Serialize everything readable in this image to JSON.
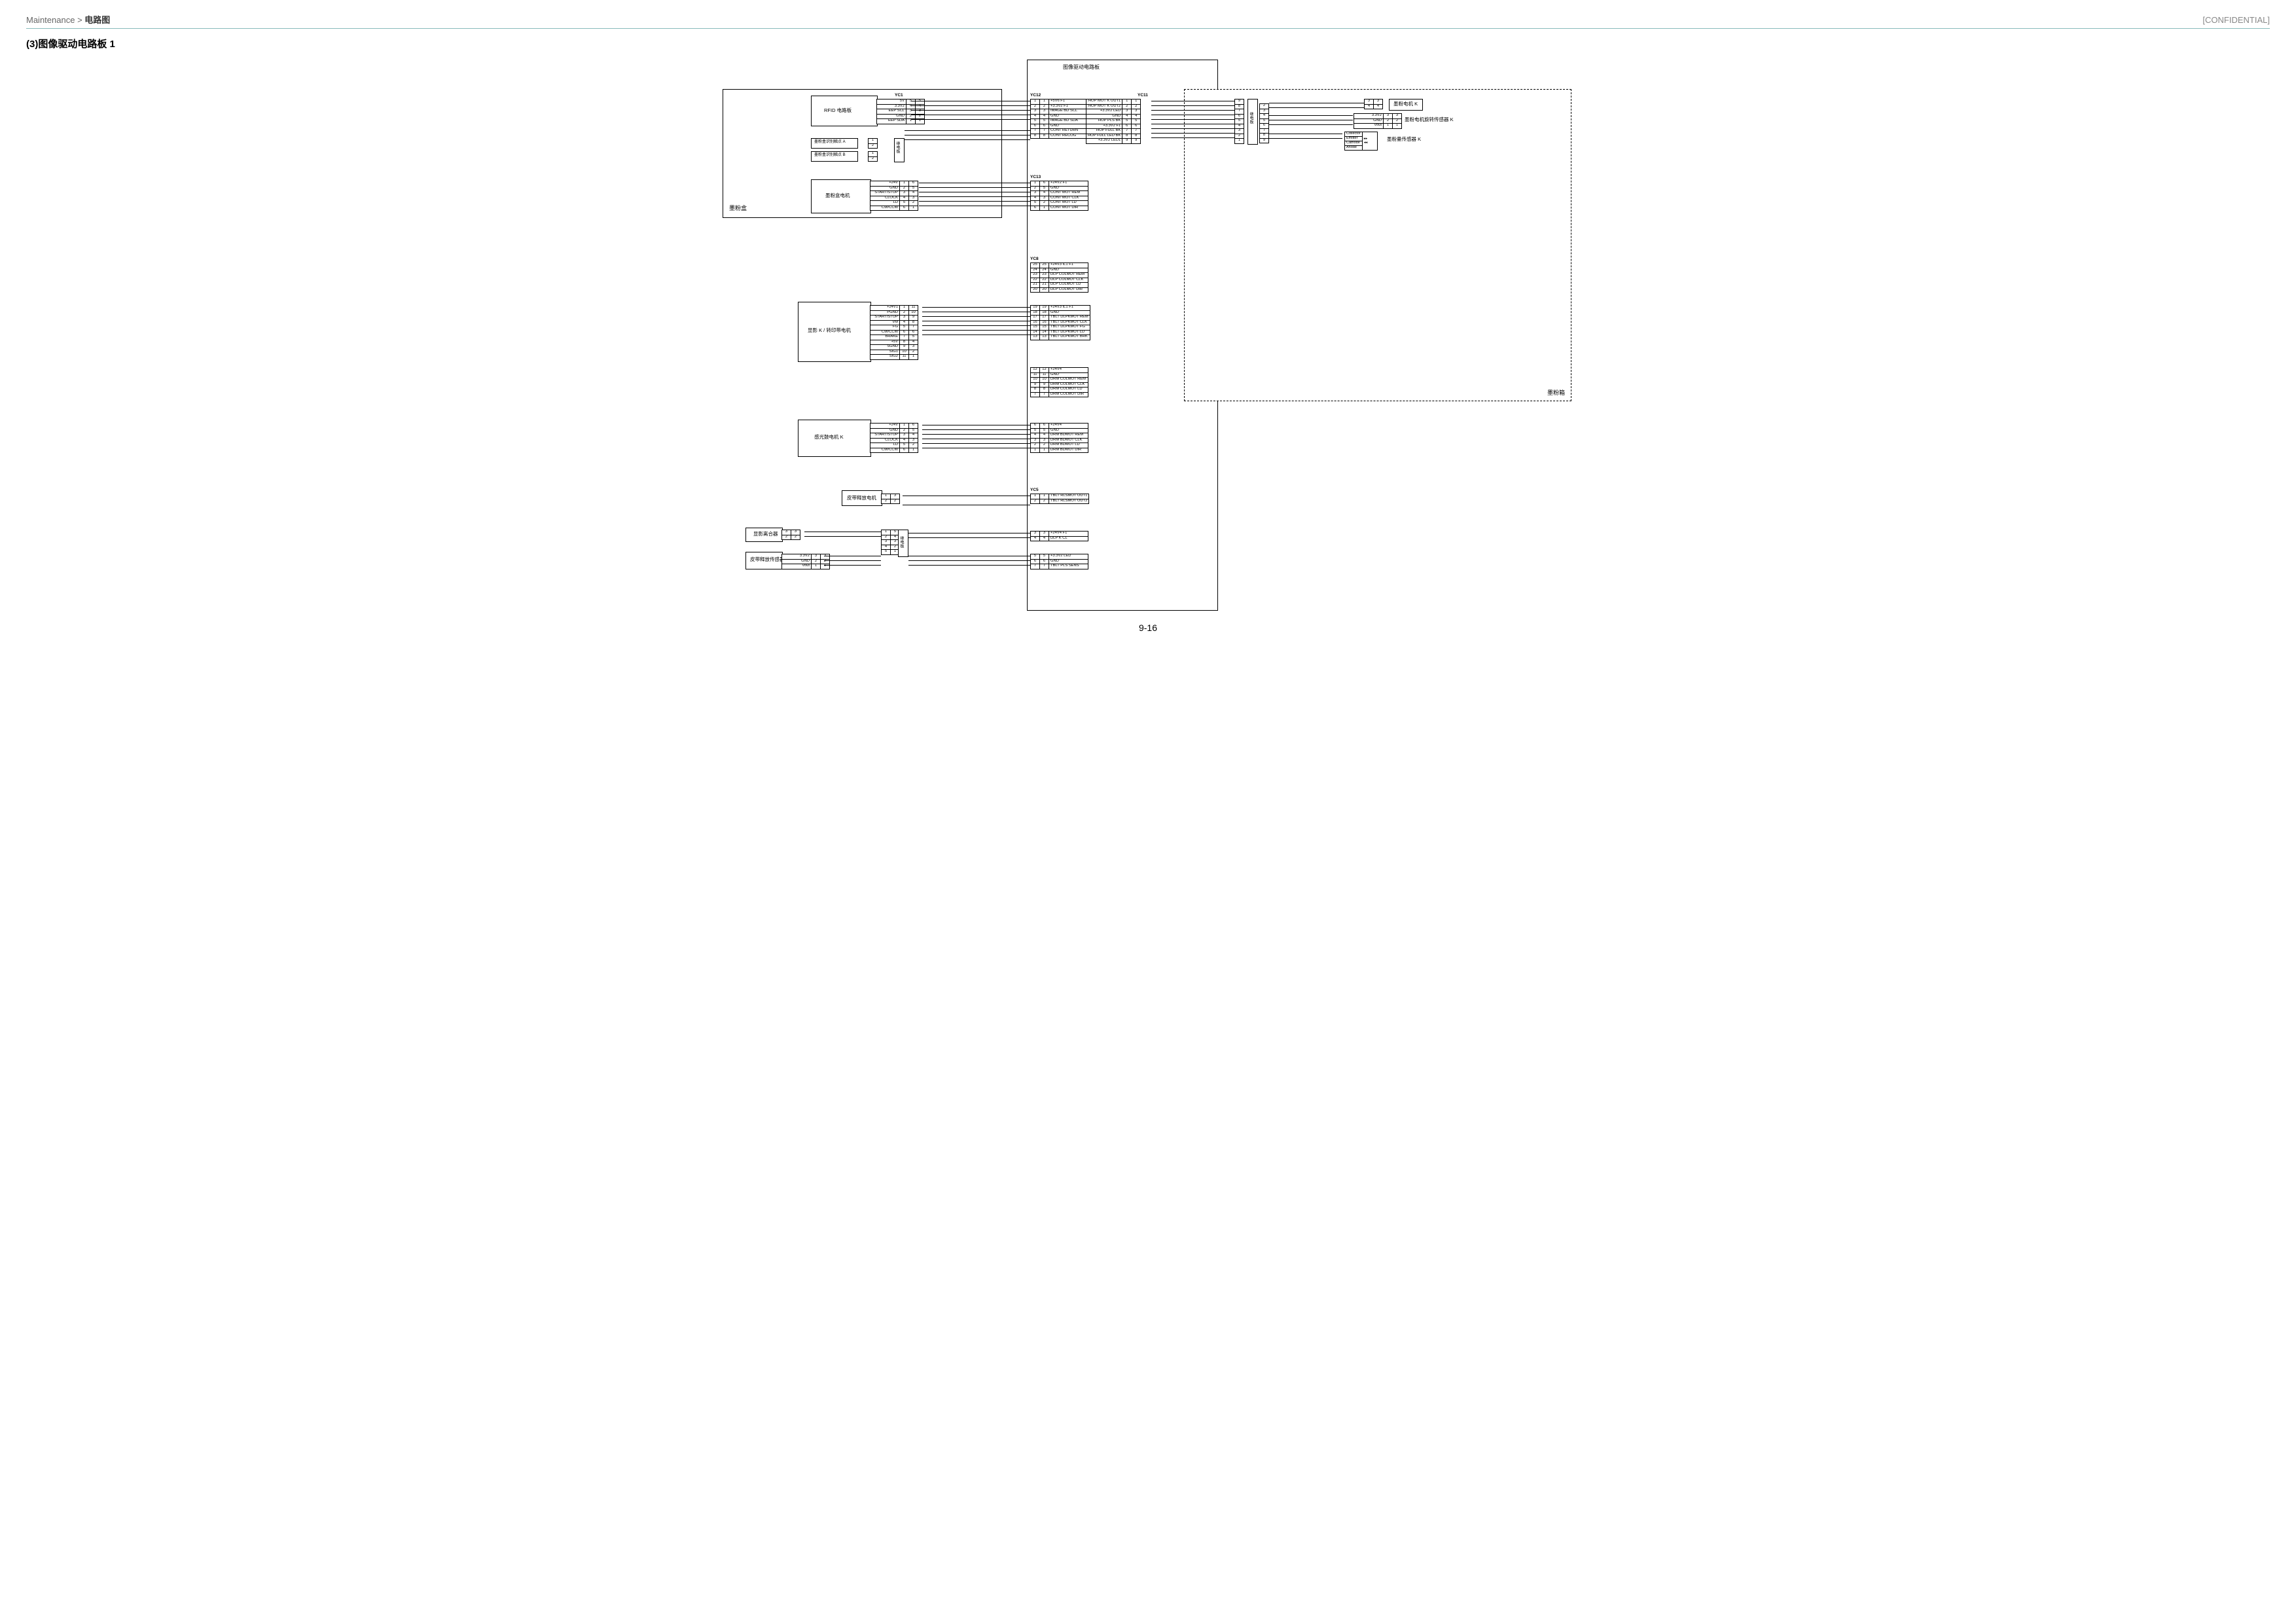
{
  "header": {
    "breadcrumb_parent": "Maintenance",
    "breadcrumb_sep": " > ",
    "breadcrumb_current": "电路图",
    "confidential": "[CONFIDENTIAL]"
  },
  "section_title": "(3)图像驱动电路板 1",
  "page_num": "9-16",
  "main_pcb_title": "图像驱动电路板",
  "toner_container_label": "墨粉盒",
  "toner_box_label": "墨粉箱",
  "blocks": {
    "rfid_pcb": "RFID 电路板",
    "toner_detect_a": "墨粉盒识别触点 A",
    "toner_detect_b": "墨粉盒识别触点 B",
    "toner_motor": "墨粉盒电机",
    "dev_transfer_motor": "显影 K / 转印带电机",
    "drum_motor_k": "感光鼓电机 K",
    "belt_release_motor": "皮带释放电机",
    "dev_clutch": "显影离合器",
    "belt_release_sensor": "皮带释放传感器",
    "toner_motor_k": "墨粉电机 K",
    "toner_rotation_sensor_k": "墨粉电机旋转传感器 K",
    "toner_amount_sensor_k": "墨粉量传感器 K",
    "relay_a": "继电板",
    "relay_b": "继电板"
  },
  "connectors": {
    "YC1": {
      "pins": [
        {
          "sig": "5V",
          "a": "5",
          "b": "5"
        },
        {
          "sig": "3.3V2",
          "a": "4",
          "b": "4"
        },
        {
          "sig": "EEP SCL",
          "a": "3",
          "b": "3"
        },
        {
          "sig": "GND",
          "a": "2",
          "b": "2"
        },
        {
          "sig": "EEP SDA",
          "a": "1",
          "b": "1"
        }
      ]
    },
    "YC12": {
      "pins": [
        {
          "a": "1",
          "b": "1",
          "sig": "+5V6 F1"
        },
        {
          "a": "2",
          "b": "2",
          "sig": "+3.3V2 F1"
        },
        {
          "a": "3",
          "b": "3",
          "sig": "IMAGE BD SCL"
        },
        {
          "a": "4",
          "b": "4",
          "sig": "GND"
        },
        {
          "a": "5",
          "b": "5",
          "sig": "IMAGE BD SDA"
        },
        {
          "a": "6",
          "b": "6",
          "sig": "GND"
        },
        {
          "a": "7",
          "b": "7",
          "sig": "CONT RETURN"
        },
        {
          "a": "8",
          "b": "8",
          "sig": "CONT RECOG"
        }
      ]
    },
    "YC13": {
      "pins": [
        {
          "a": "1",
          "b": "6",
          "sig": "+24V2 F1"
        },
        {
          "a": "2",
          "b": "5",
          "sig": "GND"
        },
        {
          "a": "3",
          "b": "4",
          "sig": "CONT MOT REM"
        },
        {
          "a": "4",
          "b": "3",
          "sig": "CONT MOT CLK"
        },
        {
          "a": "5",
          "b": "2",
          "sig": "CONT MOT LD"
        },
        {
          "a": "6",
          "b": "1",
          "sig": "CONT MOT DIR"
        }
      ]
    },
    "YC11": {
      "pins": [
        {
          "sig": "HOP MOT K OUT1",
          "a": "1",
          "b": "1"
        },
        {
          "sig": "HOP MOT K OUT2",
          "a": "2",
          "b": "2"
        },
        {
          "sig": "+3.3V2 LED",
          "a": "3",
          "b": "3"
        },
        {
          "sig": "GND",
          "a": "4",
          "b": "4"
        },
        {
          "sig": "HOP PLS BK",
          "a": "5",
          "b": "5"
        },
        {
          "sig": "+3.3V2 F1",
          "a": "6",
          "b": "6"
        },
        {
          "sig": "HOP FULL BK",
          "a": "7",
          "b": "7"
        },
        {
          "sig": "HOP FULL LED BK",
          "a": "8",
          "b": "8"
        },
        {
          "sig": "+3.3V2 LED1",
          "a": "9",
          "b": "9"
        }
      ]
    },
    "YC8": {
      "groups": [
        [
          {
            "a": "25",
            "b": "25",
            "sig": "+24V3 IL1 F1"
          },
          {
            "a": "24",
            "b": "24",
            "sig": "GND"
          },
          {
            "a": "23",
            "b": "23",
            "sig": "DLP COLMOT REM"
          },
          {
            "a": "22",
            "b": "22",
            "sig": "DLP COLMOT CLK"
          },
          {
            "a": "21",
            "b": "21",
            "sig": "DLP COLMOT LD"
          },
          {
            "a": "20",
            "b": "20",
            "sig": "DLP COLMOT DIR"
          }
        ],
        [
          {
            "a": "19",
            "b": "19",
            "sig": "+24V3 IL1 F1"
          },
          {
            "a": "18",
            "b": "18",
            "sig": "GND"
          },
          {
            "a": "17",
            "b": "17",
            "sig": "TBLT DLPKMOT REM"
          },
          {
            "a": "16",
            "b": "16",
            "sig": "TBLT DLPKMOT CLK"
          },
          {
            "a": "15",
            "b": "15",
            "sig": "TBLT DLPKMOT FG"
          },
          {
            "a": "14",
            "b": "14",
            "sig": "TBLT DLPKMOT LD"
          },
          {
            "a": "13",
            "b": "13",
            "sig": "TBLT DLPKMOT BRK"
          }
        ],
        [
          {
            "a": "12",
            "b": "12",
            "sig": "+24V4"
          },
          {
            "a": "11",
            "b": "11",
            "sig": "GND"
          },
          {
            "a": "10",
            "b": "10",
            "sig": "DRM COLMOT REM"
          },
          {
            "a": "9",
            "b": "9",
            "sig": "DRM COLMOT CLK"
          },
          {
            "a": "8",
            "b": "8",
            "sig": "DRM COLMOT LD"
          },
          {
            "a": "7",
            "b": "7",
            "sig": "DRM COLMOT DIR"
          }
        ],
        [
          {
            "a": "6",
            "b": "6",
            "sig": "+24V4"
          },
          {
            "a": "5",
            "b": "5",
            "sig": "GND"
          },
          {
            "a": "4",
            "b": "4",
            "sig": "DRM BDMOT REM"
          },
          {
            "a": "3",
            "b": "3",
            "sig": "DRM BDMOT CLK"
          },
          {
            "a": "2",
            "b": "2",
            "sig": "DRM BDMOT LD"
          },
          {
            "a": "1",
            "b": "1",
            "sig": "DRM BDMOT DIR"
          }
        ]
      ]
    },
    "YC5": {
      "groups": [
        [
          {
            "a": "1",
            "b": "1",
            "sig": "TBLT RLSMOT OUT1"
          },
          {
            "a": "2",
            "b": "2",
            "sig": "TBLT RLSMOT OUT2"
          }
        ],
        [
          {
            "a": "3",
            "b": "3",
            "sig": "+24V4 F1"
          },
          {
            "a": "4",
            "b": "4",
            "sig": "DLP K CL"
          }
        ],
        [
          {
            "a": "5",
            "b": "5",
            "sig": "+3.3V2 LED"
          },
          {
            "a": "6",
            "b": "6",
            "sig": "GND"
          },
          {
            "a": "7",
            "b": "7",
            "sig": "TBLT PLS SENS"
          }
        ]
      ]
    },
    "toner_motor_left": {
      "pins": [
        {
          "sig": "+24V",
          "a": "1",
          "b": "6"
        },
        {
          "sig": "GND",
          "a": "2",
          "b": "5"
        },
        {
          "sig": "START/STOP",
          "a": "3",
          "b": "4"
        },
        {
          "sig": "CLOCK",
          "a": "4",
          "b": "3"
        },
        {
          "sig": "LD",
          "a": "5",
          "b": "2"
        },
        {
          "sig": "CW/CCW",
          "a": "6",
          "b": "1"
        }
      ]
    },
    "dev_transfer_left": {
      "pins": [
        {
          "sig": "+24V1",
          "a": "1",
          "b": "11"
        },
        {
          "sig": "PGND",
          "a": "2",
          "b": "10"
        },
        {
          "sig": "START/STOP",
          "a": "3",
          "b": "9"
        },
        {
          "sig": "VM",
          "a": "4",
          "b": "8"
        },
        {
          "sig": "FG",
          "a": "5",
          "b": "7"
        },
        {
          "sig": "CW/CCW",
          "a": "6",
          "b": "6"
        },
        {
          "sig": "BRAKE",
          "a": "7",
          "b": "5"
        },
        {
          "sig": "+5V",
          "a": "8",
          "b": "4"
        },
        {
          "sig": "SGND",
          "a": "9",
          "b": "3"
        },
        {
          "sig": "SIG1",
          "a": "10",
          "b": "2"
        },
        {
          "sig": "SIG2",
          "a": "11",
          "b": "1"
        }
      ]
    },
    "drum_k_left": {
      "pins": [
        {
          "sig": "+24V",
          "a": "1",
          "b": "6"
        },
        {
          "sig": "GND",
          "a": "2",
          "b": "5"
        },
        {
          "sig": "START/STOP",
          "a": "3",
          "b": "4"
        },
        {
          "sig": "CLOCK",
          "a": "4",
          "b": "3"
        },
        {
          "sig": "LD",
          "a": "5",
          "b": "2"
        },
        {
          "sig": "CW/CCW",
          "a": "6",
          "b": "1"
        }
      ]
    },
    "detect_a": [
      {
        "a": "1"
      },
      {
        "a": "2"
      }
    ],
    "detect_b": [
      {
        "a": "1"
      },
      {
        "a": "2"
      }
    ],
    "belt_release": [
      {
        "a": "1",
        "b": "3"
      },
      {
        "a": "2",
        "b": "2"
      }
    ],
    "dev_clutch": [
      {
        "a": "3",
        "b": "3"
      },
      {
        "a": "2",
        "b": "2"
      }
    ],
    "belt_sensor": [
      {
        "sig": "3.3V2",
        "a": "3",
        "b": "3"
      },
      {
        "sig": "GND",
        "a": "2",
        "b": "2"
      },
      {
        "sig": "Vout",
        "a": "1",
        "b": "1"
      }
    ],
    "right_motor_k": [
      {
        "a": "3",
        "b": "3"
      },
      {
        "a": "4",
        "b": "4"
      }
    ],
    "right_sensor_rot": [
      {
        "sig": "3.3V2",
        "a": "3",
        "b": "3"
      },
      {
        "sig": "GND",
        "a": "2",
        "b": "2"
      },
      {
        "sig": "Vout",
        "a": "1",
        "b": "1"
      }
    ],
    "right_relay_a": [
      {
        "a": "9"
      },
      {
        "a": "8"
      },
      {
        "a": "7"
      },
      {
        "a": "6"
      },
      {
        "a": "5"
      },
      {
        "a": "4"
      },
      {
        "a": "3"
      },
      {
        "a": "2"
      },
      {
        "a": "1"
      }
    ],
    "right_relay_b": [
      {
        "a": "2"
      },
      {
        "a": "3"
      },
      {
        "a": "4"
      },
      {
        "a": "5"
      },
      {
        "a": "6"
      },
      {
        "a": "7"
      },
      {
        "a": "8"
      },
      {
        "a": "9"
      }
    ],
    "left_relay": [
      {
        "a": "1",
        "b": "5"
      },
      {
        "a": "2",
        "b": "4"
      },
      {
        "a": "3",
        "b": "3"
      },
      {
        "a": "4",
        "b": "2"
      },
      {
        "a": "5",
        "b": "1"
      }
    ]
  },
  "diode": {
    "collector": "Collector",
    "emitter": "Emitter",
    "cathode": "Cathode",
    "anode": "Anode"
  }
}
